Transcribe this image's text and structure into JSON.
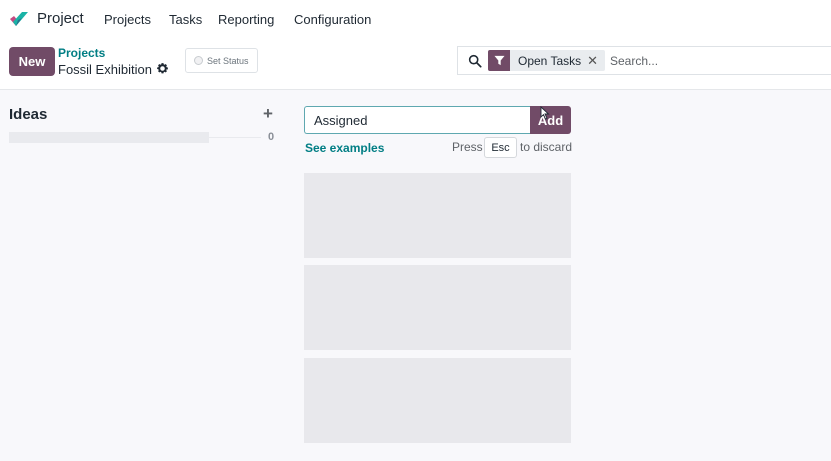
{
  "nav": {
    "app_name": "Project",
    "menu": [
      "Projects",
      "Tasks",
      "Reporting",
      "Configuration"
    ]
  },
  "control": {
    "new_label": "New",
    "breadcrumb_parent": "Projects",
    "breadcrumb_current": "Fossil Exhibition",
    "set_status_label": "Set Status"
  },
  "search": {
    "facet_label": "Open Tasks",
    "placeholder": "Search..."
  },
  "kanban": {
    "column_title": "Ideas",
    "column_count": "0",
    "quick_create": {
      "value": "Assigned",
      "add_label": "Add",
      "see_examples": "See examples",
      "press_text": "Press",
      "key": "Esc",
      "discard_text": "to discard"
    }
  },
  "colors": {
    "brand": "#714b67",
    "link": "#017e84",
    "logo_teal": "#1ab3a6",
    "logo_pink": "#c44a82"
  }
}
